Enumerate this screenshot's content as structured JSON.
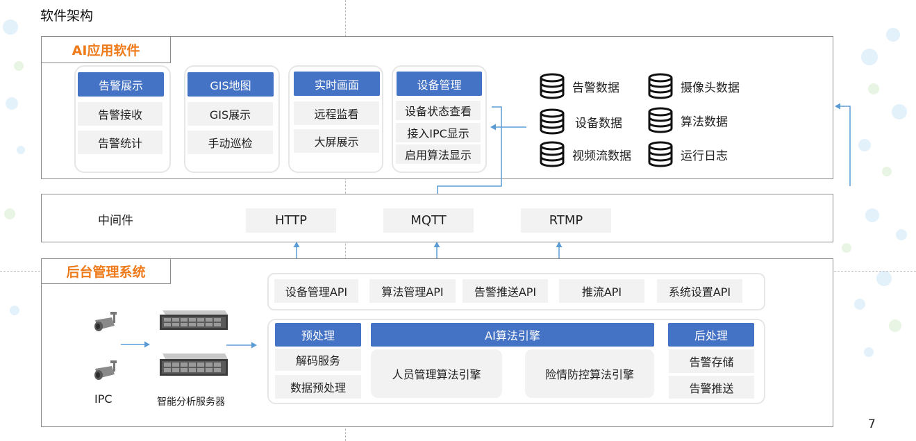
{
  "page_title": "软件架构",
  "page_number": "7",
  "ai_app": {
    "tab": "AI应用软件",
    "groups": [
      {
        "header": "告警展示",
        "items": [
          "告警接收",
          "告警统计"
        ]
      },
      {
        "header": "GIS地图",
        "items": [
          "GIS展示",
          "手动巡检"
        ]
      },
      {
        "header": "实时画面",
        "items": [
          "远程监看",
          "大屏展示"
        ]
      },
      {
        "header": "设备管理",
        "items": [
          "设备状态查看",
          "接入IPC显示",
          "启用算法显示"
        ]
      }
    ],
    "data_stores": [
      "告警数据",
      "摄像头数据",
      "设备数据",
      "算法数据",
      "视频流数据",
      "运行日志"
    ]
  },
  "middleware": {
    "label": "中间件",
    "protocols": [
      "HTTP",
      "MQTT",
      "RTMP"
    ]
  },
  "backend": {
    "tab": "后台管理系统",
    "apis": [
      "设备管理API",
      "算法管理API",
      "告警推送API",
      "推流API",
      "系统设置API"
    ],
    "pre": {
      "header": "预处理",
      "items": [
        "解码服务",
        "数据预处理"
      ]
    },
    "engine": {
      "header": "AI算法引擎",
      "items": [
        "人员管理算法引擎",
        "险情防控算法引擎"
      ]
    },
    "post": {
      "header": "后处理",
      "items": [
        "告警存储",
        "告警推送"
      ]
    },
    "camera_label": "IPC",
    "server_label": "智能分析服务器"
  },
  "colors": {
    "accent": "#4472c4",
    "tab_text": "#ee7a1a",
    "arrow": "#5b9bd5"
  }
}
